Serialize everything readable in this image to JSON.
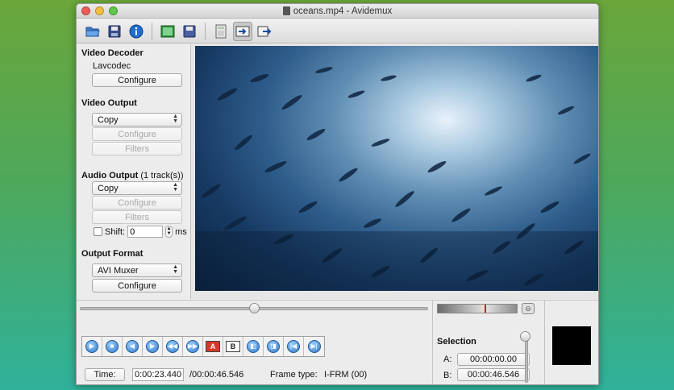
{
  "window": {
    "title": "oceans.mp4 - Avidemux"
  },
  "traffic_lights": {
    "close_color": "#ee5c55",
    "minimize_color": "#f5bd40",
    "zoom_color": "#5fc84a"
  },
  "toolbar": {
    "buttons": [
      {
        "name": "open-folder-icon"
      },
      {
        "name": "save-icon"
      },
      {
        "name": "info-icon"
      },
      {
        "name": "open-video-icon"
      },
      {
        "name": "save-video-icon"
      },
      {
        "name": "calculator-icon"
      },
      {
        "name": "output-video-icon",
        "active": true
      },
      {
        "name": "input-video-icon"
      }
    ]
  },
  "video_decoder": {
    "title": "Video Decoder",
    "codec": "Lavcodec",
    "configure_label": "Configure"
  },
  "video_output": {
    "title": "Video Output",
    "selected": "Copy",
    "configure_label": "Configure",
    "filters_label": "Filters"
  },
  "audio_output": {
    "title": "Audio Output",
    "tracks": "(1 track(s))",
    "selected": "Copy",
    "configure_label": "Configure",
    "filters_label": "Filters",
    "shift_label": "Shift:",
    "shift_value": "0",
    "shift_unit": "ms"
  },
  "output_format": {
    "title": "Output Format",
    "selected": "AVI Muxer",
    "configure_label": "Configure"
  },
  "playback": {
    "position_fraction": 0.5,
    "time_label": "Time:",
    "current_time": "0:00:23.440",
    "total_time": "/00:00:46.546",
    "frame_type_label": "Frame type:",
    "frame_type_value": "I-FRM (00)"
  },
  "controls": [
    {
      "name": "play-icon",
      "glyph": "▶"
    },
    {
      "name": "stop-icon",
      "glyph": "■"
    },
    {
      "name": "previous-frame-icon",
      "glyph": "◀"
    },
    {
      "name": "next-frame-icon",
      "glyph": "▶"
    },
    {
      "name": "previous-keyframe-icon",
      "glyph": "◀◀"
    },
    {
      "name": "next-keyframe-icon",
      "glyph": "▶▶"
    },
    {
      "name": "set-marker-a-icon",
      "glyph": "A"
    },
    {
      "name": "set-marker-b-icon",
      "glyph": "B"
    },
    {
      "name": "previous-black-frame-icon",
      "glyph": "◧"
    },
    {
      "name": "next-black-frame-icon",
      "glyph": "◨"
    },
    {
      "name": "go-first-frame-icon",
      "glyph": "|◀"
    },
    {
      "name": "go-last-frame-icon",
      "glyph": "▶|"
    }
  ],
  "selection": {
    "title": "Selection",
    "a_label": "A:",
    "a_value": "00:00:00.00",
    "b_label": "B:",
    "b_value": "00:00:46.546"
  },
  "colors": {
    "accent_blue": "#2f78c6",
    "marker_red": "#d41a1a"
  }
}
